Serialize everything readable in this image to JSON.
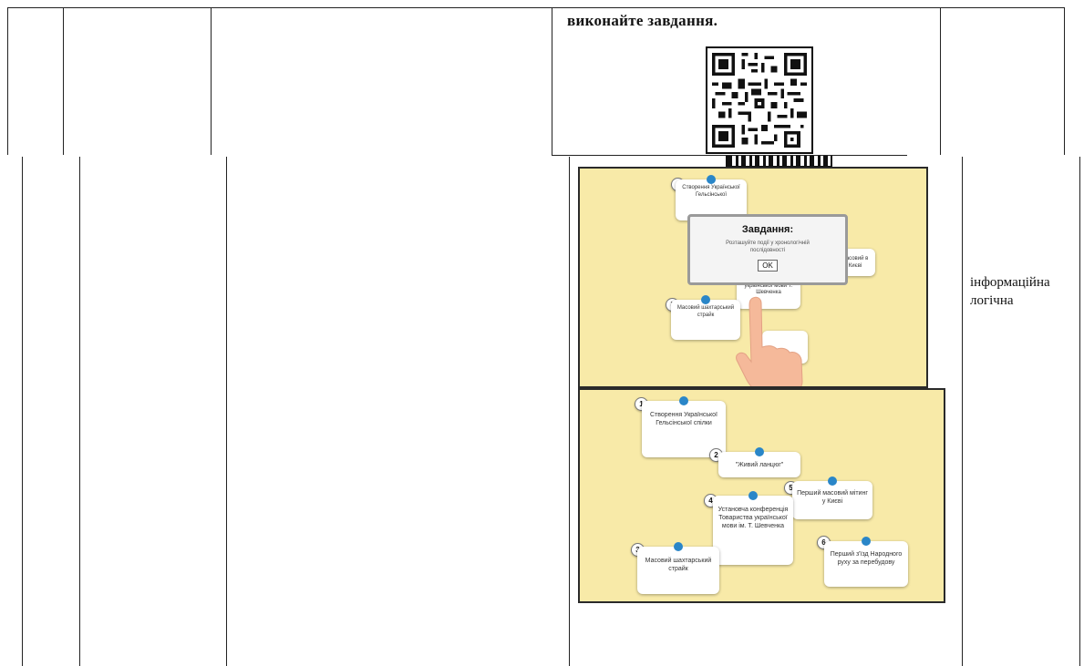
{
  "doc": {
    "instruction_tail": "виконайте завдання.",
    "skills_line1": "інформаційна",
    "skills_line2": "логічна"
  },
  "screenshot_top": {
    "cards": [
      {
        "num": "1",
        "text": "Створення Української Гельсінської"
      },
      {
        "num": "3",
        "text": "Масовий шахтарський страйк"
      },
      {
        "num": "",
        "text": "Товариства української мови Т. Шевченка"
      },
      {
        "num": "",
        "text": "масовий в Києві"
      }
    ],
    "modal": {
      "title": "Завдання:",
      "body": "Розташуйте події у хронологічній послідовності",
      "ok": "OK"
    }
  },
  "screenshot_bottom": {
    "cards": [
      {
        "num": "1",
        "text": "Створення Української Гельсінської спілки"
      },
      {
        "num": "2",
        "text": "\"Живий ланцюг\""
      },
      {
        "num": "3",
        "text": "Масовий шахтарський страйк"
      },
      {
        "num": "4",
        "text": "Установча конференція Товариства української мови ім. Т. Шевченка"
      },
      {
        "num": "5",
        "text": "Перший масовий мітинг у Києві"
      },
      {
        "num": "6",
        "text": "Перший з'їзд Народного руху за перебудову"
      }
    ]
  },
  "colors": {
    "game_background": "#f8eaa8",
    "marker_dot": "#2a86c8",
    "table_lines": "#222222"
  },
  "icons": [
    "qr-code-icon",
    "pointing-hand-icon"
  ]
}
